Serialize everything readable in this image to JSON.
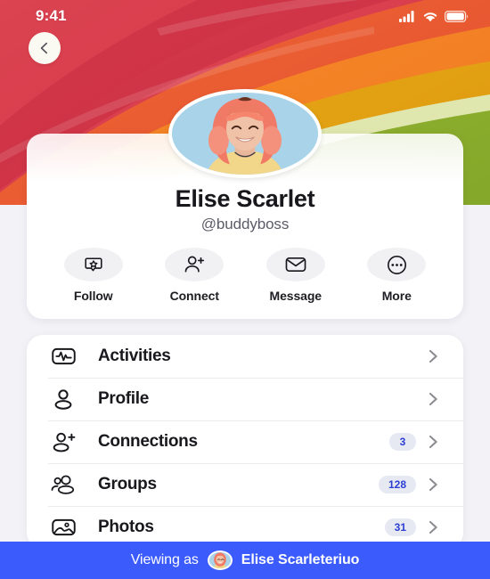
{
  "status_bar": {
    "time": "9:41",
    "signal_icon": "cellular-signal-icon",
    "wifi_icon": "wifi-icon",
    "battery_icon": "battery-full-icon"
  },
  "nav": {
    "back_icon": "chevron-left-icon"
  },
  "cover": {
    "type": "rainbow-gradient-photo",
    "bands": [
      "#d8344a",
      "#e8563a",
      "#f07a22",
      "#e8a015",
      "#d9e2a8",
      "#86a82a"
    ]
  },
  "profile": {
    "avatar_icon": "user-avatar-photo",
    "display_name": "Elise Scarlet",
    "handle": "@buddyboss",
    "actions": [
      {
        "label": "Follow",
        "icon": "follow-star-bubble-icon"
      },
      {
        "label": "Connect",
        "icon": "person-add-icon"
      },
      {
        "label": "Message",
        "icon": "envelope-icon"
      },
      {
        "label": "More",
        "icon": "more-dots-circle-icon"
      }
    ]
  },
  "menu": {
    "chevron_icon": "chevron-right-icon",
    "items": [
      {
        "label": "Activities",
        "icon": "activity-pulse-icon",
        "badge": ""
      },
      {
        "label": "Profile",
        "icon": "person-icon",
        "badge": ""
      },
      {
        "label": "Connections",
        "icon": "person-add-icon",
        "badge": "3"
      },
      {
        "label": "Groups",
        "icon": "people-group-icon",
        "badge": "128"
      },
      {
        "label": "Photos",
        "icon": "photo-image-icon",
        "badge": "31"
      }
    ]
  },
  "viewing_as": {
    "label": "Viewing as",
    "avatar_icon": "user-avatar-photo-small",
    "name": "Elise Scarleteriuo",
    "bar_color": "#3b5bfd"
  }
}
